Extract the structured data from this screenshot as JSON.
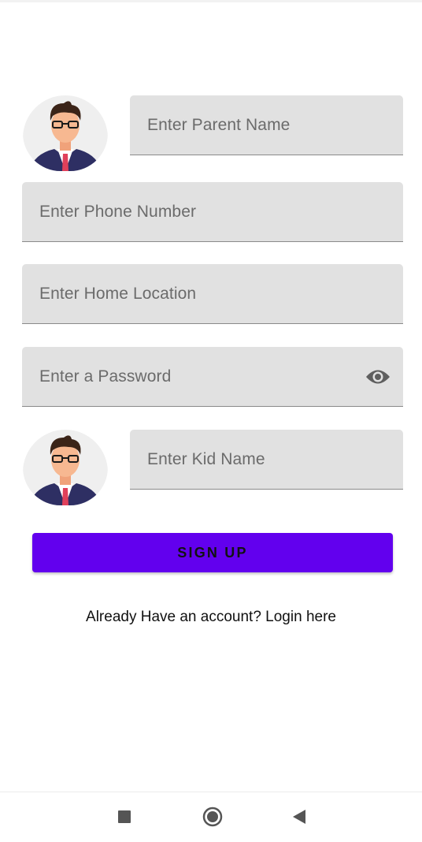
{
  "form": {
    "parent_name_placeholder": "Enter Parent Name",
    "phone_placeholder": "Enter Phone Number",
    "location_placeholder": "Enter Home Location",
    "password_placeholder": "Enter a Password",
    "kid_name_placeholder": "Enter Kid Name",
    "password_toggle_icon": "eye-icon",
    "avatar_icon": "businessman-avatar-icon"
  },
  "actions": {
    "signup_label": "SIGN UP",
    "login_prompt": "Already Have an account? Login here"
  },
  "nav": {
    "recents_icon": "square-icon",
    "home_icon": "circle-icon",
    "back_icon": "triangle-back-icon"
  },
  "colors": {
    "primary": "#6200ee",
    "field_background": "#e1e1e1",
    "placeholder_text": "#6b6b6b"
  }
}
